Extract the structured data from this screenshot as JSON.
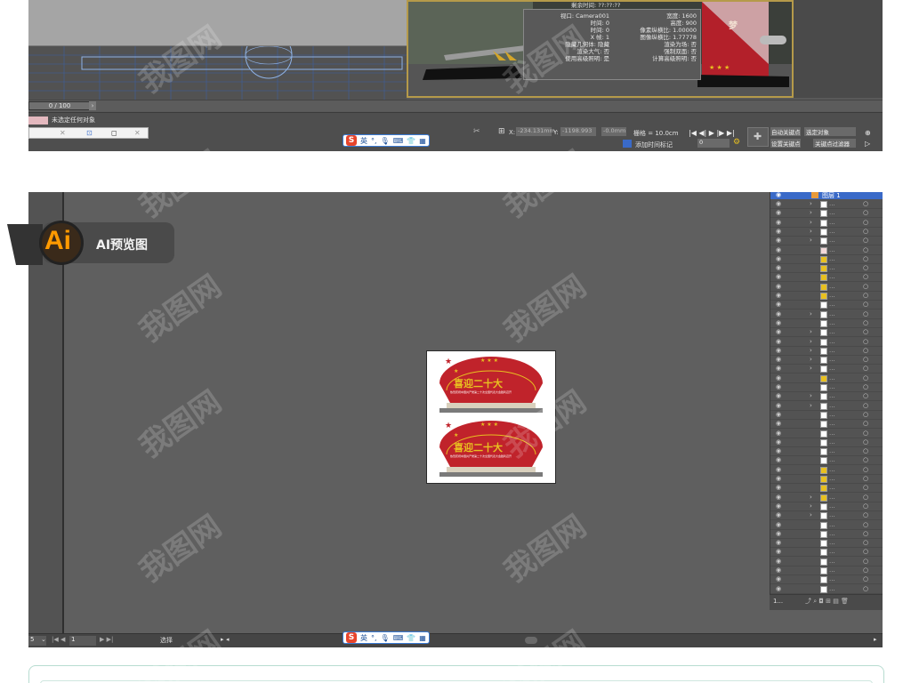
{
  "max": {
    "render_time_label": "剩余时间: ??:??:??",
    "dialog": {
      "left_col": [
        "视口: Camera001",
        "时间: 0",
        "时间: 0",
        "X 帧: 1",
        "隐藏几何体: 隐藏",
        "渲染大气: 否",
        "使用高级照明: 是"
      ],
      "right_col": [
        "宽度: 1600",
        "高度: 900",
        "像素纵横比: 1.00000",
        "图像纵横比: 1.77778",
        "渲染为场: 否",
        "强制双面: 否",
        "计算高级照明: 否"
      ]
    },
    "scene_text": "梦",
    "timeline_value": "0 / 100",
    "status_text": "未选定任何对象",
    "coord_x_label": "X:",
    "coord_x_value": "-234.131mm",
    "coord_y_label": "Y:",
    "coord_y_value": "-1198.993",
    "coord_z_value": "-0.0mm",
    "grid_label": "栅格 = 10.0cm",
    "add_time_tag": "添加时间标记",
    "auto_key": "自动关键点",
    "set_key": "设置关键点",
    "selected_object": "选定对象",
    "key_filter": "关键点过滤器",
    "frame_value": "0"
  },
  "ime": {
    "label": "英"
  },
  "badge": {
    "logo": "Ai",
    "text": "AI预览图"
  },
  "artboard": {
    "headline": "喜迎二十大",
    "subtext": "热烈庆祝中国共产党第二十次全国代表大会胜利召开"
  },
  "layers": {
    "top_layer_name": "图层 1",
    "footer_count": "1..."
  },
  "ai_bottom": {
    "zoom_value": "5",
    "page_value": "1",
    "status": "选择"
  },
  "watermark": "我图网",
  "colors": {
    "red": "#c0232b",
    "gold": "#e8c020",
    "badge_orange": "#ff9a00",
    "badge_dark": "#3a2a1a"
  }
}
